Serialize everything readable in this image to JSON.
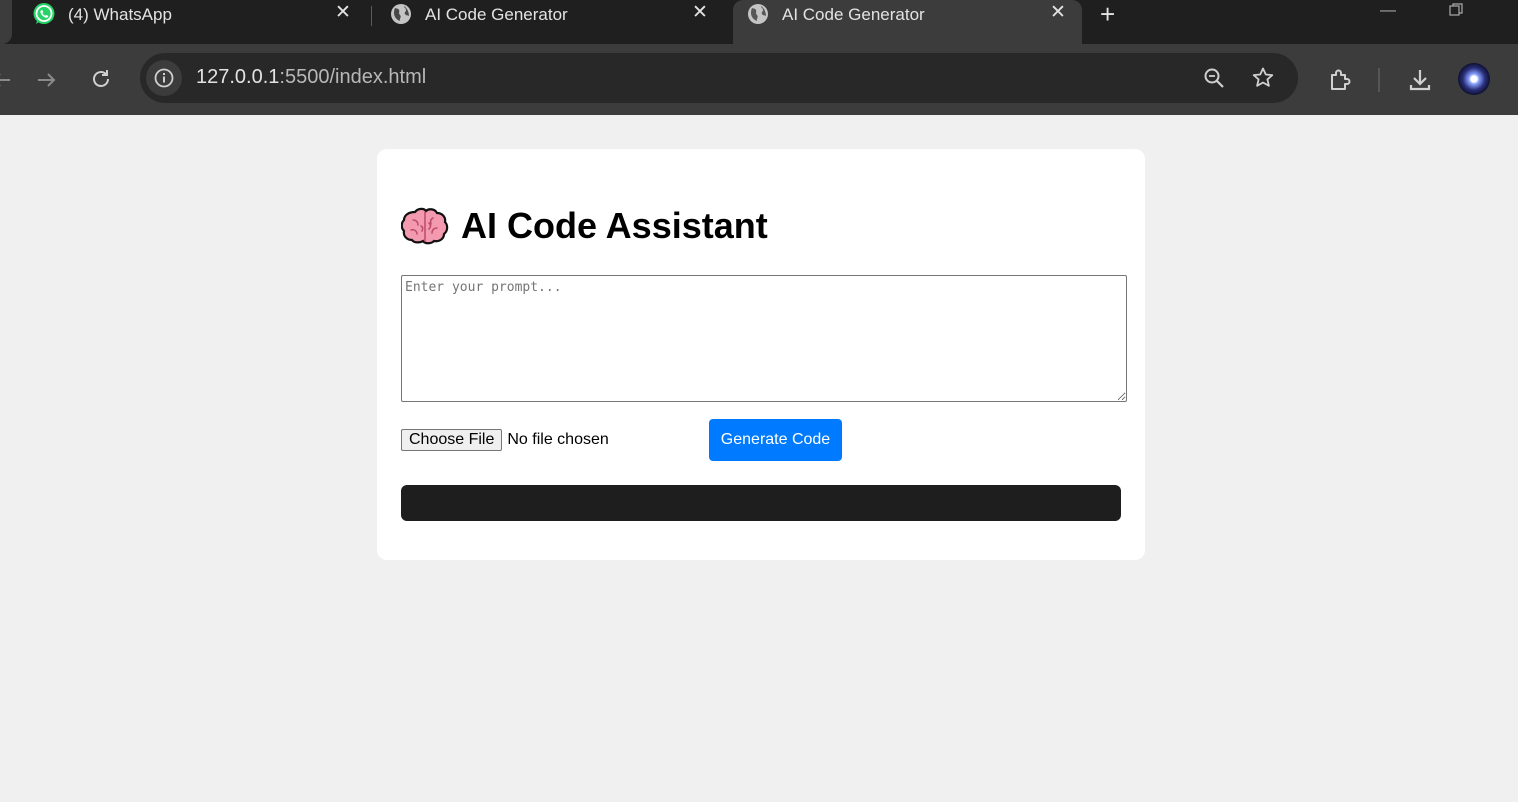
{
  "browser": {
    "tabs": [
      {
        "title": "(4) WhatsApp",
        "favicon": "whatsapp-icon",
        "active": false
      },
      {
        "title": "AI Code Generator",
        "favicon": "globe-icon",
        "active": false
      },
      {
        "title": "AI Code Generator",
        "favicon": "globe-icon",
        "active": true
      }
    ],
    "address": {
      "host": "127.0.0.1",
      "rest": ":5500/index.html"
    }
  },
  "page": {
    "heading": "AI Code Assistant",
    "heading_icon": "brain-emoji",
    "prompt_placeholder": "Enter your prompt...",
    "choose_file_label": "Choose File",
    "file_status": "No file chosen",
    "generate_label": "Generate Code",
    "output_text": ""
  },
  "colors": {
    "primary_button": "#007bff",
    "output_bg": "#1e1e1e",
    "page_bg": "#f0f0f0"
  }
}
